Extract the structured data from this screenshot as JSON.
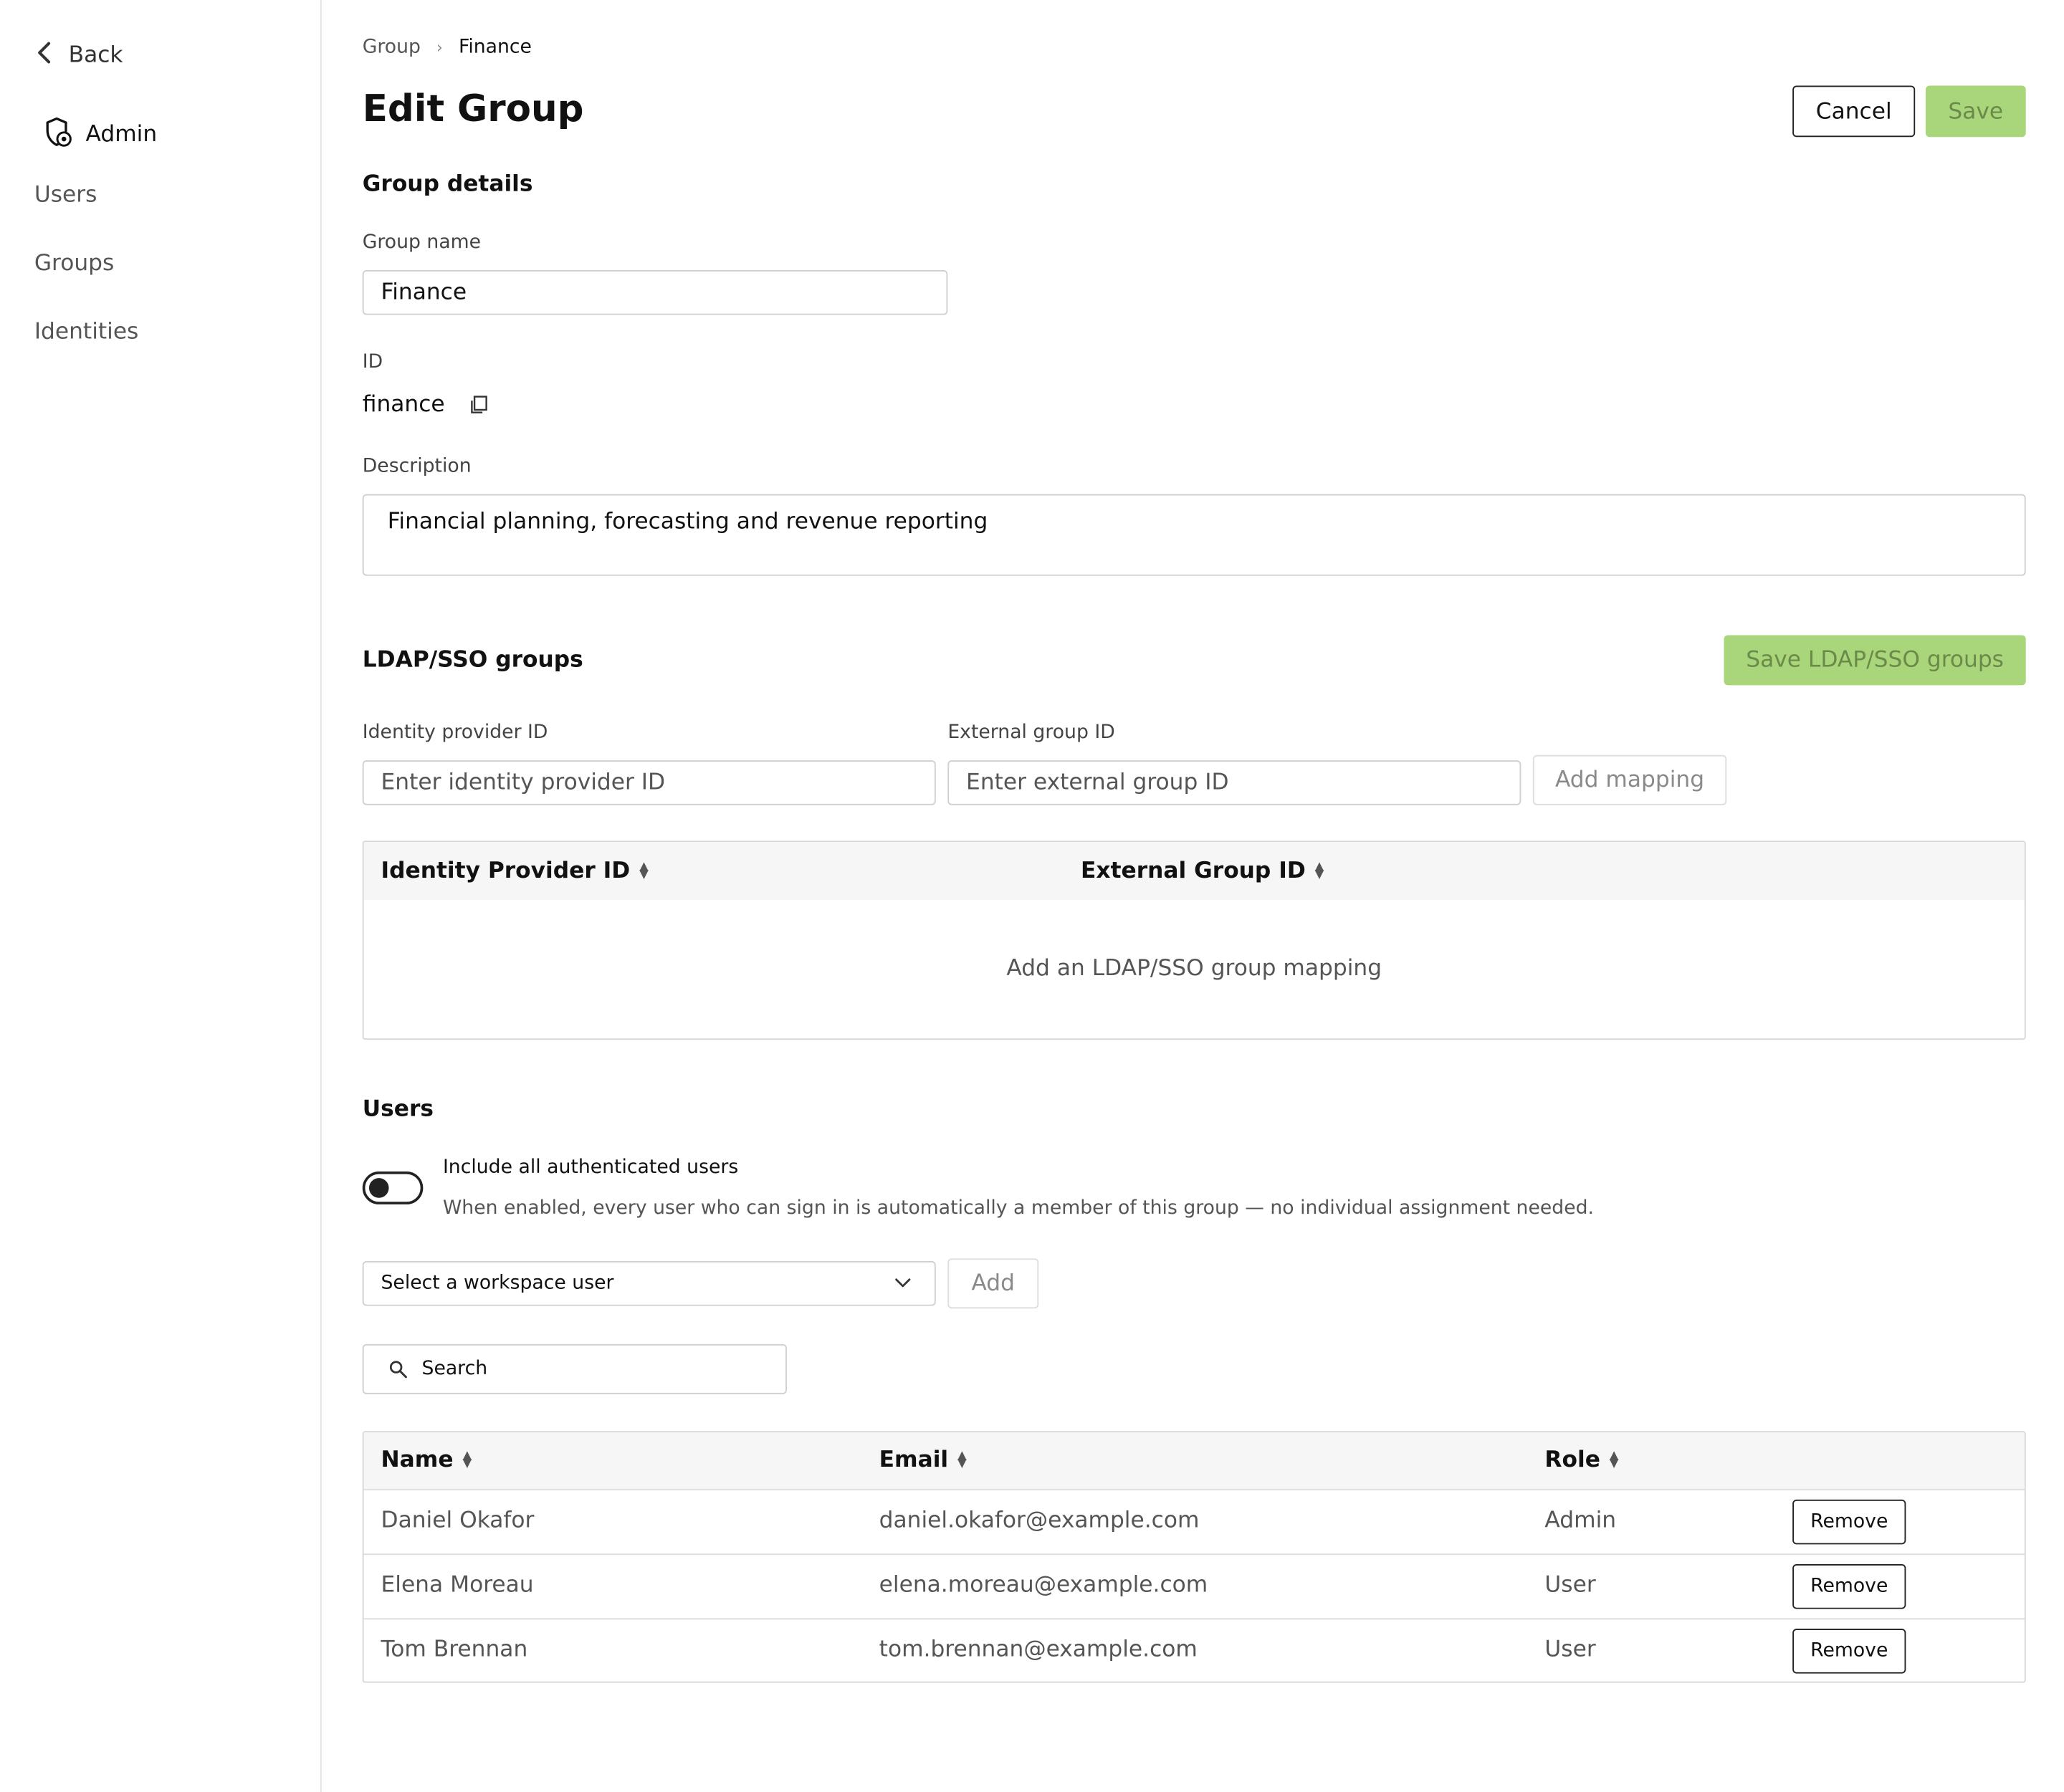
{
  "sidebar": {
    "back_label": "Back",
    "admin_label": "Admin",
    "items": [
      {
        "label": "Users"
      },
      {
        "label": "Groups"
      },
      {
        "label": "Identities"
      }
    ]
  },
  "breadcrumb": {
    "parent": "Group",
    "current": "Finance"
  },
  "header": {
    "title": "Edit Group",
    "cancel_label": "Cancel",
    "save_label": "Save"
  },
  "group_details": {
    "title": "Group details",
    "name_label": "Group name",
    "name_value": "Finance",
    "id_label": "ID",
    "id_value": "finance",
    "description_label": "Description",
    "description_value": "Financial planning, forecasting and revenue reporting"
  },
  "ldap": {
    "title": "LDAP/SSO groups",
    "save_label": "Save LDAP/SSO groups",
    "idp_label": "Identity provider ID",
    "idp_placeholder": "Enter identity provider ID",
    "ext_label": "External group ID",
    "ext_placeholder": "Enter external group ID",
    "add_label": "Add mapping",
    "columns": [
      "Identity Provider ID",
      "External Group ID"
    ],
    "empty_text": "Add an LDAP/SSO group mapping"
  },
  "users": {
    "title": "Users",
    "toggle_label": "Include all authenticated users",
    "toggle_desc": "When enabled, every user who can sign in is automatically a member of this group — no individual assignment needed.",
    "toggle_on": false,
    "select_placeholder": "Select a workspace user",
    "add_label": "Add",
    "search_placeholder": "Search",
    "columns": [
      "Name",
      "Email",
      "Role"
    ],
    "remove_label": "Remove",
    "rows": [
      {
        "name": "Daniel Okafor",
        "email": "daniel.okafor@example.com",
        "role": "Admin"
      },
      {
        "name": "Elena Moreau",
        "email": "elena.moreau@example.com",
        "role": "User"
      },
      {
        "name": "Tom Brennan",
        "email": "tom.brennan@example.com",
        "role": "User"
      }
    ]
  },
  "colors": {
    "accent_green": "#a9d67a",
    "border": "#cfcfcf",
    "header_bg": "#f6f6f6"
  }
}
